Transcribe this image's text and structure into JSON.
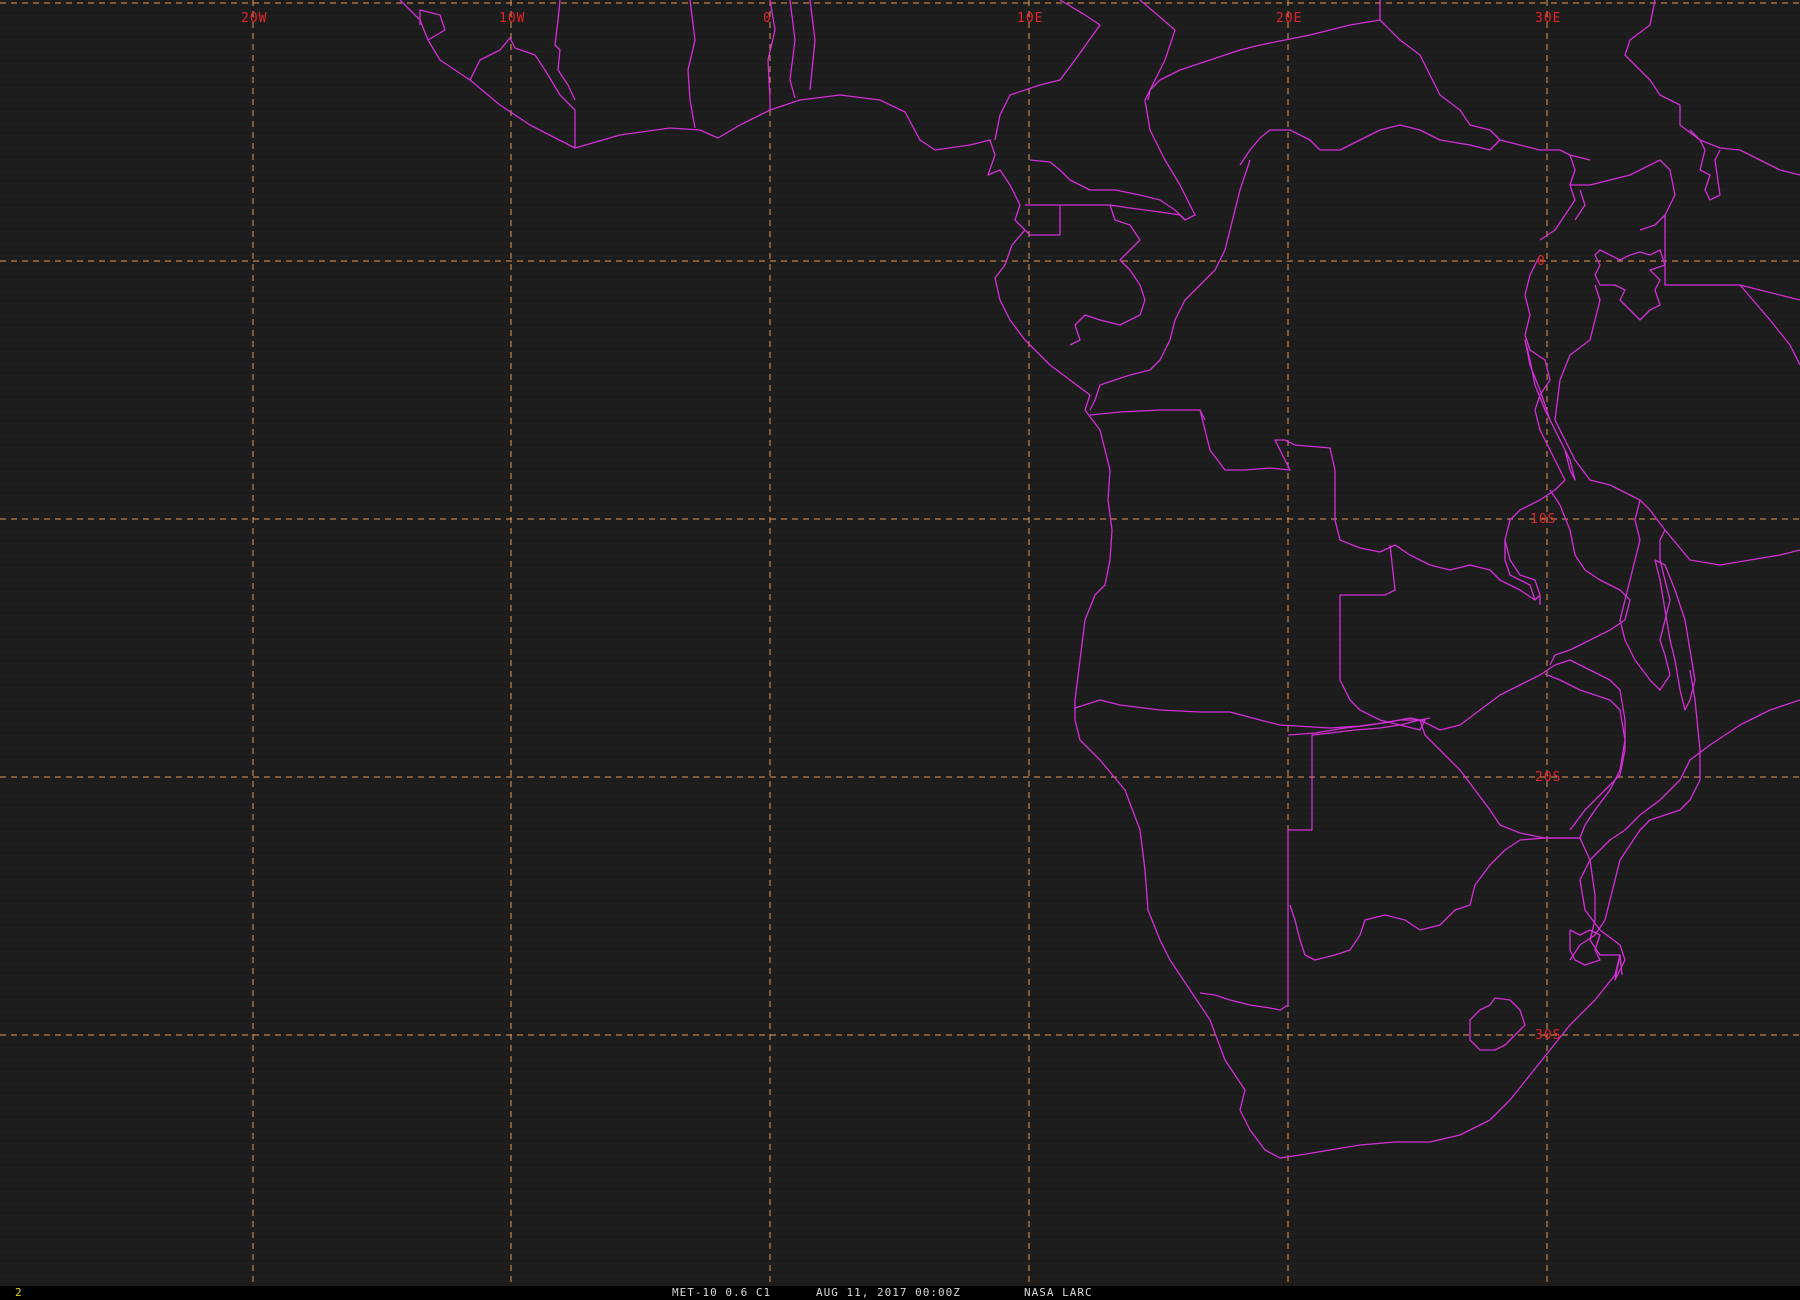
{
  "colors": {
    "background": "#1c1c1c",
    "grid": "#e0985a",
    "grid_labels": "#e0252a",
    "borders": "#d42ed8",
    "status_text": "#d8d8d8",
    "frame_number": "#e3d21e"
  },
  "grid": {
    "longitude_labels": [
      "20W",
      "10W",
      "0",
      "10E",
      "20E",
      "30E"
    ],
    "latitude_labels": [
      "0",
      "10S",
      "20S",
      "30S"
    ]
  },
  "status_bar": {
    "frame": "2",
    "product": "MET-10 0.6 C1",
    "datetime": "AUG 11, 2017 00:00Z",
    "source": "NASA LARC"
  }
}
